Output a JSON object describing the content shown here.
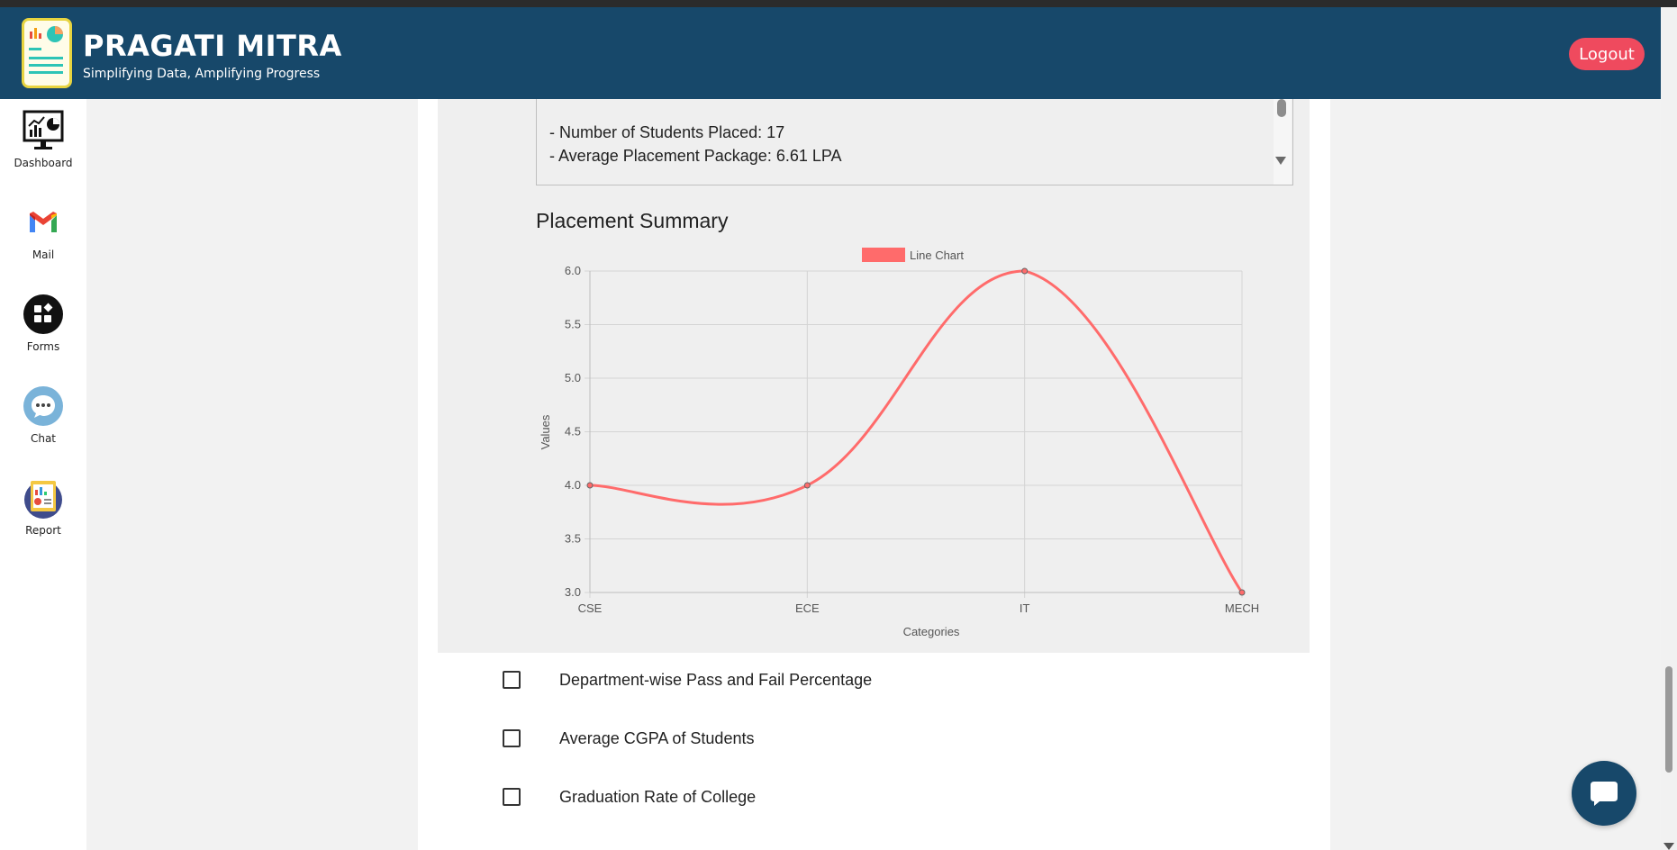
{
  "header": {
    "title": "PRAGATI MITRA",
    "subtitle": "Simplifying Data, Amplifying Progress",
    "logout_label": "Logout"
  },
  "sidebar": {
    "items": [
      {
        "label": "Dashboard",
        "icon": "dashboard-icon"
      },
      {
        "label": "Mail",
        "icon": "mail-icon"
      },
      {
        "label": "Forms",
        "icon": "forms-icon"
      },
      {
        "label": "Chat",
        "icon": "chat-icon"
      },
      {
        "label": "Report",
        "icon": "report-icon"
      }
    ]
  },
  "summary": {
    "lines": [
      "- Number of Students Placed: 17",
      "- Average Placement Package: 6.61 LPA"
    ]
  },
  "chart_section": {
    "title": "Placement Summary"
  },
  "chart_data": {
    "type": "line",
    "categories": [
      "CSE",
      "ECE",
      "IT",
      "MECH"
    ],
    "series": [
      {
        "name": "Line Chart",
        "values": [
          4.0,
          4.0,
          6.0,
          3.0
        ],
        "color": "#ff6b6b"
      }
    ],
    "xlabel": "Categories",
    "ylabel": "Values",
    "ylim": [
      3.0,
      6.0
    ],
    "yticks": [
      "3.0",
      "3.5",
      "4.0",
      "4.5",
      "5.0",
      "5.5",
      "6.0"
    ],
    "grid": true,
    "legend": "top-center"
  },
  "options": [
    {
      "label": "Department-wise Pass and Fail Percentage",
      "checked": false
    },
    {
      "label": "Average CGPA of Students",
      "checked": false
    },
    {
      "label": "Graduation Rate of College",
      "checked": false
    }
  ],
  "colors": {
    "header": "#17486a",
    "logout": "#ef4a5e",
    "series": "#ff6b6b"
  }
}
